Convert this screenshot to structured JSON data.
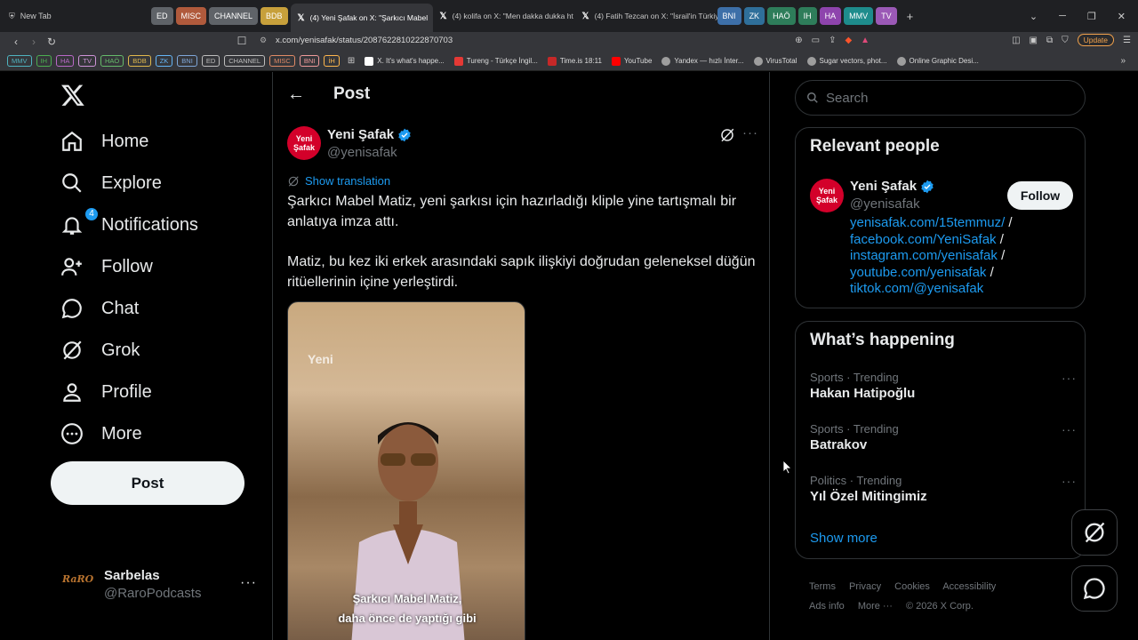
{
  "browser": {
    "new_tab_label": "New Tab",
    "tab_groups": [
      {
        "label": "ED",
        "color": "#5f6368"
      },
      {
        "label": "MISC",
        "color": "#b05a3c"
      },
      {
        "label": "CHANNEL",
        "color": "#5f6368"
      },
      {
        "label": "BDB",
        "color": "#c7a03b"
      }
    ],
    "tabs": [
      {
        "title": "(4) Yeni Şafak on X: \"Şarkıcı Mabel",
        "active": true
      },
      {
        "title": "(4) kolifa on X: \"Men dakka dukka ht",
        "active": false
      },
      {
        "title": "(4) Fatih Tezcan on X: \"İsrail'in Türkiye",
        "active": false
      }
    ],
    "tab_groups_right": [
      {
        "label": "BNI",
        "color": "#3d6fa8"
      },
      {
        "label": "ZK",
        "color": "#2f6f9a"
      },
      {
        "label": "HAÖ",
        "color": "#2e7d5a"
      },
      {
        "label": "IH",
        "color": "#2e7d5a"
      },
      {
        "label": "HA",
        "color": "#8e44ad"
      },
      {
        "label": "MMV",
        "color": "#1e8c8c"
      },
      {
        "label": "TV",
        "color": "#9b59b6"
      }
    ],
    "url": "x.com/yenisafak/status/2087622810222870703",
    "update_label": "Update",
    "bookmark_groups": [
      {
        "label": "MMV",
        "color": "#4fb3bf"
      },
      {
        "label": "IH",
        "color": "#4caf50"
      },
      {
        "label": "HA",
        "color": "#ba68c8"
      },
      {
        "label": "TV",
        "color": "#ce93d8"
      },
      {
        "label": "HAÖ",
        "color": "#66bb6a"
      },
      {
        "label": "BDB",
        "color": "#e0b84c"
      },
      {
        "label": "ZK",
        "color": "#64b5f6"
      },
      {
        "label": "BNI",
        "color": "#7fa7d9"
      },
      {
        "label": "ED",
        "color": "#bdbdbd"
      },
      {
        "label": "CHANNEL",
        "color": "#bdbdbd"
      },
      {
        "label": "MISC",
        "color": "#e08a66"
      },
      {
        "label": "BNI",
        "color": "#ef9a9a"
      },
      {
        "label": "İH",
        "color": "#ffb74d"
      }
    ],
    "bookmarks": [
      {
        "label": "X. It's what's happe...",
        "icon_color": "#ffffff"
      },
      {
        "label": "Tureng - Türkçe İngil...",
        "icon_color": "#e53935"
      },
      {
        "label": "Time.is 18:11",
        "icon_color": "#c62828"
      },
      {
        "label": "YouTube",
        "icon_color": "#ff0000"
      },
      {
        "label": "Yandex — hızlı İnter...",
        "icon_color": "#9e9e9e"
      },
      {
        "label": "VirusTotal",
        "icon_color": "#9e9e9e"
      },
      {
        "label": "Sugar vectors, phot...",
        "icon_color": "#9e9e9e"
      },
      {
        "label": "Online Graphic Desi...",
        "icon_color": "#9e9e9e"
      }
    ]
  },
  "nav": {
    "items": [
      {
        "label": "Home",
        "icon": "home-icon"
      },
      {
        "label": "Explore",
        "icon": "search-icon"
      },
      {
        "label": "Notifications",
        "icon": "bell-icon",
        "badge": "4"
      },
      {
        "label": "Follow",
        "icon": "follow-icon"
      },
      {
        "label": "Chat",
        "icon": "chat-icon"
      },
      {
        "label": "Grok",
        "icon": "grok-icon"
      },
      {
        "label": "Profile",
        "icon": "profile-icon"
      },
      {
        "label": "More",
        "icon": "more-circle-icon"
      }
    ],
    "post_button": "Post"
  },
  "account": {
    "avatar_text": "RaRO",
    "name": "Sarbelas",
    "handle": "@RaroPodcasts",
    "more": "···"
  },
  "post": {
    "header_title": "Post",
    "author_name": "Yeni Şafak",
    "author_handle": "@yenisafak",
    "avatar_text_1": "Yeni",
    "avatar_text_2": "Şafak",
    "show_translation": "Show translation",
    "paragraph_1": "Şarkıcı Mabel Matiz, yeni şarkısı için hazırladığı kliple yine tartışmalı bir anlatıya imza attı.",
    "paragraph_2": "Matiz, bu kez iki erkek arasındaki sapık ilişkiyi doğrudan geleneksel düğün ritüellerinin içine yerleştirdi.",
    "media_watermark": "Yeni",
    "media_caption_1": "Şarkıcı Mabel Matiz,",
    "media_caption_2": "daha önce de yaptığı gibi"
  },
  "search": {
    "placeholder": "Search"
  },
  "relevant_people": {
    "title": "Relevant people",
    "name": "Yeni Şafak",
    "handle": "@yenisafak",
    "follow_label": "Follow",
    "links": [
      "yenisafak.com/15temmuz/",
      "facebook.com/YeniSafak",
      "instagram.com/yenisafak",
      "youtube.com/yenisafak",
      "tiktok.com/@yenisafak"
    ],
    "separator": " /"
  },
  "trending": {
    "title": "What’s happening",
    "items": [
      {
        "meta": "Sports · Trending",
        "name": "Hakan Hatipoğlu"
      },
      {
        "meta": "Sports · Trending",
        "name": "Batrakov"
      },
      {
        "meta": "Politics · Trending",
        "name": "Yıl Özel Mitingimiz"
      }
    ],
    "show_more": "Show more"
  },
  "footer": {
    "links": [
      "Terms",
      "Privacy",
      "Cookies",
      "Accessibility",
      "Ads info",
      "More ···"
    ],
    "copyright": "© 2026 X Corp."
  },
  "colors": {
    "accent": "#1d9bf0",
    "background": "#000000",
    "border": "#2f3336",
    "secondary_text": "#71767b"
  }
}
